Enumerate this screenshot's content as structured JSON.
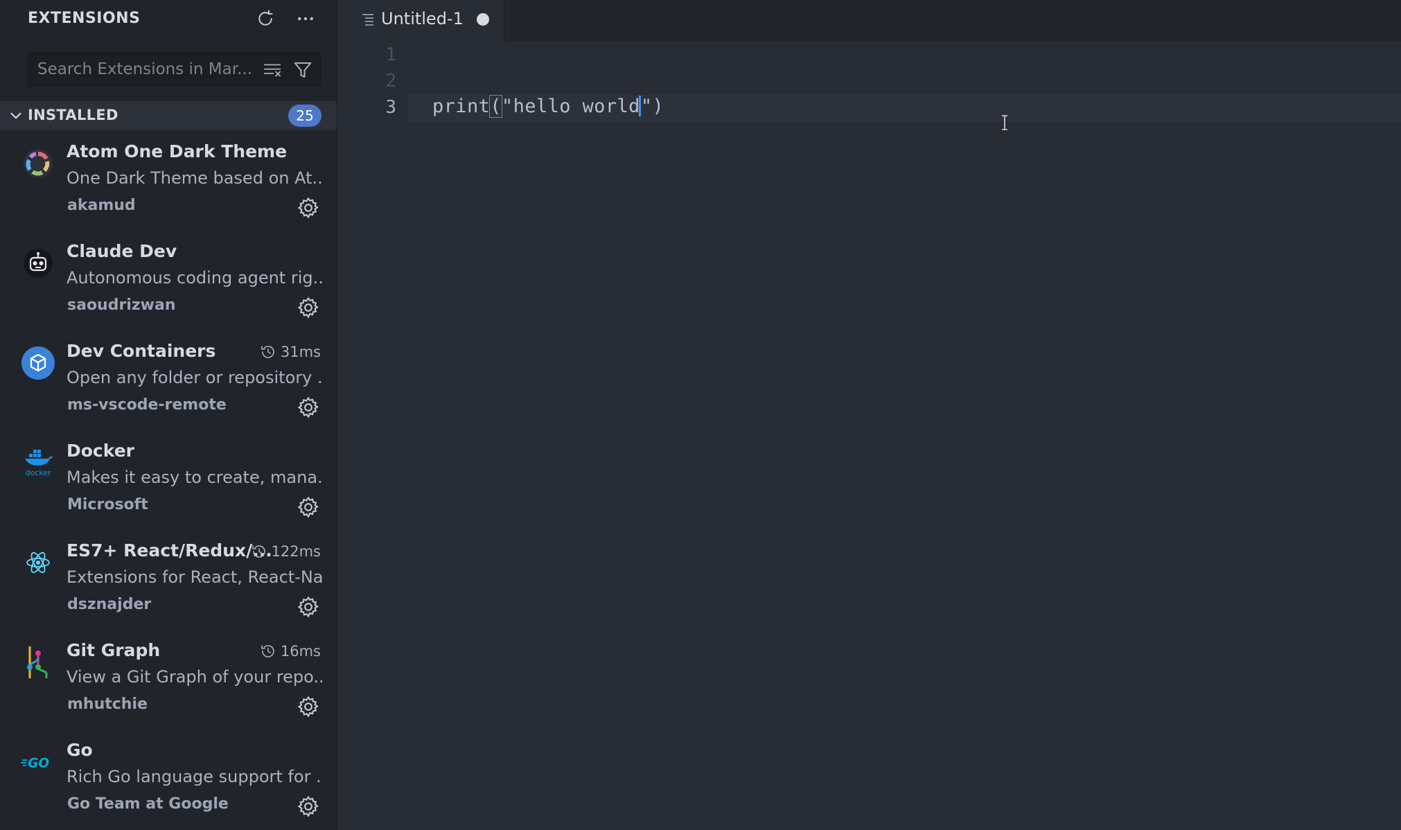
{
  "sidebar": {
    "title": "EXTENSIONS",
    "search_placeholder": "Search Extensions in Mar...",
    "section": {
      "label": "INSTALLED",
      "count": "25"
    },
    "extensions": [
      {
        "name": "Atom One Dark Theme",
        "desc": "One Dark Theme based on At...",
        "publisher": "akamud",
        "timing": ""
      },
      {
        "name": "Claude Dev",
        "desc": "Autonomous coding agent rig...",
        "publisher": "saoudrizwan",
        "timing": ""
      },
      {
        "name": "Dev Containers",
        "desc": "Open any folder or repository ...",
        "publisher": "ms-vscode-remote",
        "timing": "31ms"
      },
      {
        "name": "Docker",
        "desc": "Makes it easy to create, mana...",
        "publisher": "Microsoft",
        "timing": ""
      },
      {
        "name": "ES7+ React/Redux/...",
        "desc": "Extensions for React, React-Na...",
        "publisher": "dsznajder",
        "timing": "122ms"
      },
      {
        "name": "Git Graph",
        "desc": "View a Git Graph of your repo...",
        "publisher": "mhutchie",
        "timing": "16ms"
      },
      {
        "name": "Go",
        "desc": "Rich Go language support for ...",
        "publisher": "Go Team at Google",
        "timing": ""
      }
    ]
  },
  "editor": {
    "tab_name": "Untitled-1",
    "line_numbers": [
      "1",
      "2",
      "3"
    ],
    "code": {
      "fn": "print",
      "open_paren": "(",
      "string_before_cursor": "\"hello world",
      "string_after_cursor": "\"",
      "close_paren": ")"
    }
  },
  "icons": {
    "refresh": "refresh-icon",
    "more": "ellipsis-icon",
    "clear": "clear-filter-icon",
    "filter": "filter-icon",
    "gear": "gear-icon",
    "timing": "history-clock-icon"
  },
  "colors": {
    "accent": "#4d78cc",
    "cursor": "#528bff",
    "docker_blue": "#1d91e6",
    "react_cyan": "#61dafb",
    "go_cyan": "#00add8"
  }
}
